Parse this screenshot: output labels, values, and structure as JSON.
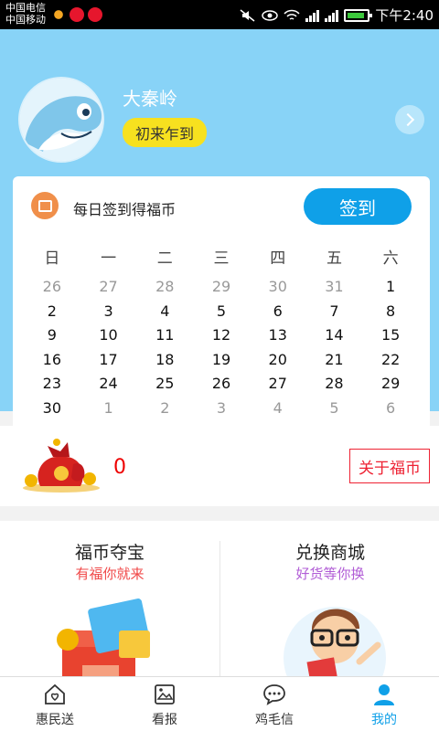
{
  "status_bar": {
    "carrier_1": "中国电信",
    "carrier_2": "中国移动",
    "time": "下午2:40",
    "icons": [
      "weather-icon",
      "weibo-icon",
      "weibo-icon",
      "mute-icon",
      "eye-icon",
      "wifi-icon",
      "signal-icon",
      "signal-icon",
      "battery-icon"
    ]
  },
  "profile": {
    "username": "大秦岭",
    "level": "初来乍到"
  },
  "sign": {
    "text": "每日签到得福币",
    "button": "签到"
  },
  "calendar": {
    "weekdays": [
      "日",
      "一",
      "二",
      "三",
      "四",
      "五",
      "六"
    ],
    "days": [
      {
        "d": "26",
        "m": true
      },
      {
        "d": "27",
        "m": true
      },
      {
        "d": "28",
        "m": true
      },
      {
        "d": "29",
        "m": true
      },
      {
        "d": "30",
        "m": true
      },
      {
        "d": "31",
        "m": true
      },
      {
        "d": "1",
        "m": false
      },
      {
        "d": "2",
        "m": false
      },
      {
        "d": "3",
        "m": false
      },
      {
        "d": "4",
        "m": false
      },
      {
        "d": "5",
        "m": false
      },
      {
        "d": "6",
        "m": false
      },
      {
        "d": "7",
        "m": false
      },
      {
        "d": "8",
        "m": false
      },
      {
        "d": "9",
        "m": false
      },
      {
        "d": "10",
        "m": false
      },
      {
        "d": "11",
        "m": false
      },
      {
        "d": "12",
        "m": false
      },
      {
        "d": "13",
        "m": false
      },
      {
        "d": "14",
        "m": false
      },
      {
        "d": "15",
        "m": false
      },
      {
        "d": "16",
        "m": false
      },
      {
        "d": "17",
        "m": false
      },
      {
        "d": "18",
        "m": false
      },
      {
        "d": "19",
        "m": false
      },
      {
        "d": "20",
        "m": false
      },
      {
        "d": "21",
        "m": false
      },
      {
        "d": "22",
        "m": false
      },
      {
        "d": "23",
        "m": false
      },
      {
        "d": "24",
        "m": false
      },
      {
        "d": "25",
        "m": false
      },
      {
        "d": "26",
        "m": false
      },
      {
        "d": "27",
        "m": false
      },
      {
        "d": "28",
        "m": false
      },
      {
        "d": "29",
        "m": false
      },
      {
        "d": "30",
        "m": false
      },
      {
        "d": "1",
        "m": true
      },
      {
        "d": "2",
        "m": true
      },
      {
        "d": "3",
        "m": true
      },
      {
        "d": "4",
        "m": true
      },
      {
        "d": "5",
        "m": true
      },
      {
        "d": "6",
        "m": true
      }
    ]
  },
  "coins": {
    "count": "0",
    "about_button": "关于福币"
  },
  "features": {
    "left": {
      "title": "福币夺宝",
      "subtitle": "有福你就来"
    },
    "right": {
      "title": "兑换商城",
      "subtitle": "好货等你换"
    }
  },
  "tabs": [
    {
      "label": "惠民送",
      "icon": "home-heart-icon",
      "active": false
    },
    {
      "label": "看报",
      "icon": "newspaper-icon",
      "active": false
    },
    {
      "label": "鸡毛信",
      "icon": "chat-icon",
      "active": false
    },
    {
      "label": "我的",
      "icon": "user-icon",
      "active": true
    }
  ],
  "colors": {
    "header_bg": "#88d3f7",
    "accent": "#0fa0e8",
    "badge": "#f7e11f",
    "coin_red": "#e00000"
  }
}
